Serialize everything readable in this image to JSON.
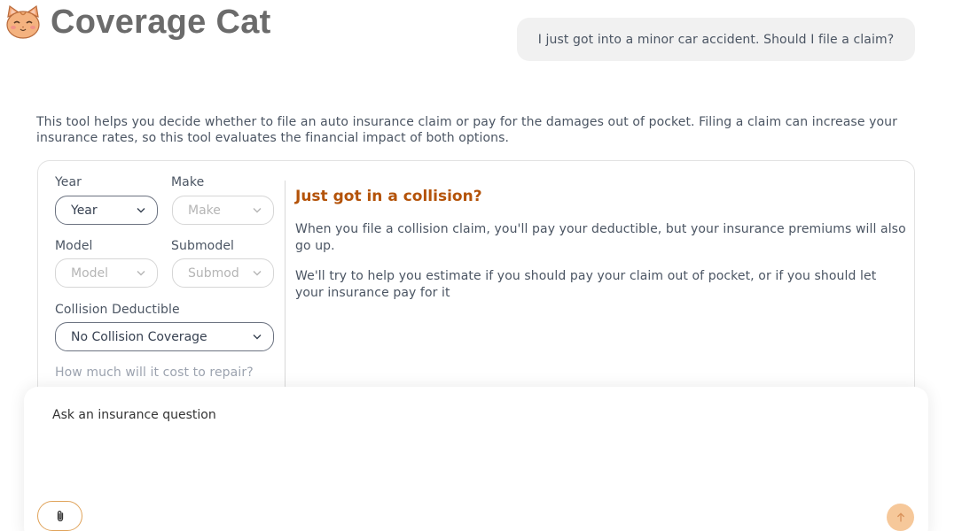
{
  "header": {
    "logo_text": "Coverage Cat",
    "logo_icon": "cat-face-icon"
  },
  "chat": {
    "user_message": "I just got into a minor car accident. Should I file a claim?"
  },
  "intro": {
    "text": "This tool helps you decide whether to file an auto insurance claim or pay for the damages out of pocket. Filing a claim can increase your insurance rates, so this tool evaluates the financial impact of both options."
  },
  "form": {
    "year_label": "Year",
    "year_value": "Year",
    "make_label": "Make",
    "make_value": "Make",
    "model_label": "Model",
    "model_value": "Model",
    "submodel_label": "Submodel",
    "submodel_value": "Submod",
    "deductible_label": "Collision Deductible",
    "deductible_value": "No Collision Coverage",
    "repair_cost_label": "How much will it cost to repair?"
  },
  "info": {
    "title": "Just got in a collision?",
    "paragraph1": "When you file a collision claim, you'll pay your deductible, but your insurance premiums will also go up.",
    "paragraph2": "We'll try to help you estimate if you should pay your claim out of pocket, or if you should let your insurance pay for it"
  },
  "composer": {
    "placeholder": "Ask an insurance question",
    "attach_icon": "paperclip-icon",
    "send_icon": "arrow-up-icon"
  },
  "colors": {
    "accent": "#b45309",
    "send_button": "#f6c89a",
    "attach_border": "#e0a35a"
  }
}
